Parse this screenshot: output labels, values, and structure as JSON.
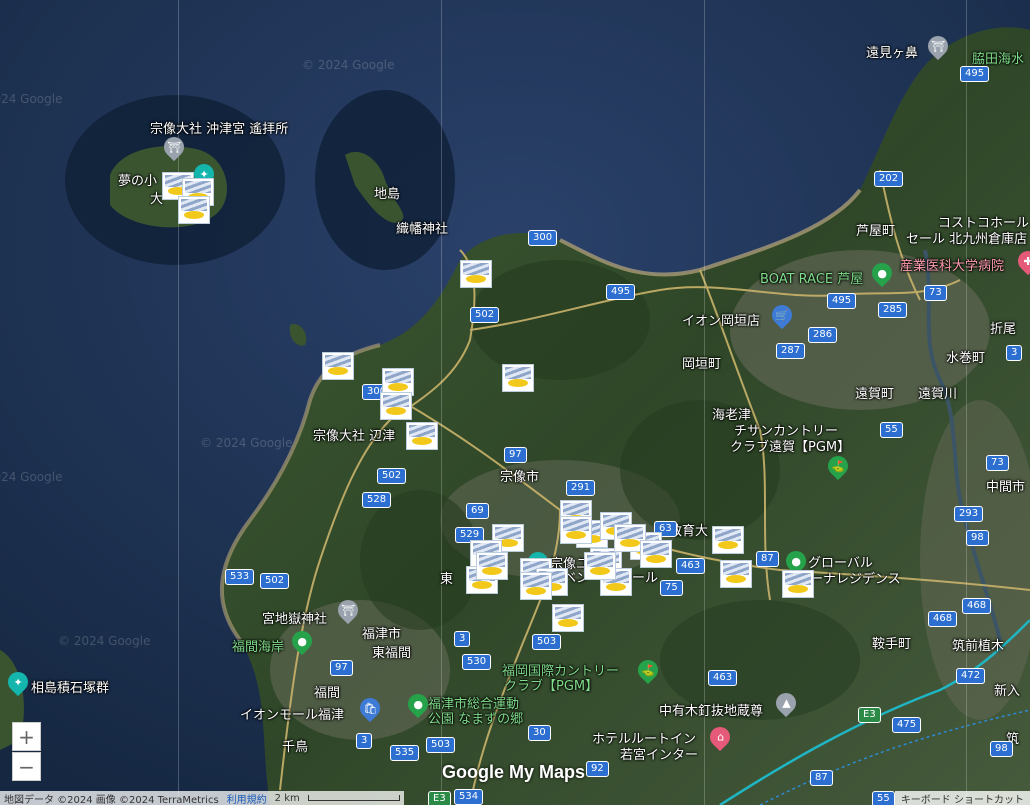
{
  "watermark": "© 2024 Google",
  "place_labels": [
    {
      "text": "遠見ヶ鼻",
      "cls": ""
    },
    {
      "text": "脇田海水",
      "cls": "green"
    },
    {
      "text": "宗像大社 沖津宮 遙拝所",
      "cls": ""
    },
    {
      "text": "夢の小",
      "cls": ""
    },
    {
      "text": "大",
      "cls": ""
    },
    {
      "text": "地島",
      "cls": ""
    },
    {
      "text": "織幡神社",
      "cls": ""
    },
    {
      "text": "芦屋町",
      "cls": ""
    },
    {
      "text": "コストコホール",
      "cls": ""
    },
    {
      "text": "セール 北九州倉庫店",
      "cls": ""
    },
    {
      "text": "産業医科大学病院",
      "cls": "pink"
    },
    {
      "text": "BOAT RACE 芦屋",
      "cls": "green"
    },
    {
      "text": "イオン岡垣店",
      "cls": ""
    },
    {
      "text": "折尾",
      "cls": ""
    },
    {
      "text": "岡垣町",
      "cls": ""
    },
    {
      "text": "水巻町",
      "cls": ""
    },
    {
      "text": "遠賀町",
      "cls": ""
    },
    {
      "text": "遠賀川",
      "cls": ""
    },
    {
      "text": "海老津",
      "cls": ""
    },
    {
      "text": "チサンカントリー",
      "cls": ""
    },
    {
      "text": "クラブ遠賀【PGM】",
      "cls": ""
    },
    {
      "text": "宗像大社 辺津",
      "cls": ""
    },
    {
      "text": "宗像市",
      "cls": ""
    },
    {
      "text": "中間市",
      "cls": ""
    },
    {
      "text": "教育大",
      "cls": ""
    },
    {
      "text": "宗像ユ",
      "cls": ""
    },
    {
      "text": "イベン",
      "cls": ""
    },
    {
      "text": "ール",
      "cls": ""
    },
    {
      "text": "東",
      "cls": ""
    },
    {
      "text": "グローバル",
      "cls": ""
    },
    {
      "text": "アリーナレジデンス",
      "cls": ""
    },
    {
      "text": "宮地嶽神社",
      "cls": ""
    },
    {
      "text": "福間海岸",
      "cls": "green"
    },
    {
      "text": "福津市",
      "cls": ""
    },
    {
      "text": "東福間",
      "cls": ""
    },
    {
      "text": "鞍手町",
      "cls": ""
    },
    {
      "text": "筑前植木",
      "cls": ""
    },
    {
      "text": "相島積石塚群",
      "cls": ""
    },
    {
      "text": "福間",
      "cls": ""
    },
    {
      "text": "福岡国際カントリー",
      "cls": "green"
    },
    {
      "text": "クラブ【PGM】",
      "cls": "green"
    },
    {
      "text": "新入",
      "cls": ""
    },
    {
      "text": "イオンモール福津",
      "cls": ""
    },
    {
      "text": "福津市総合運動",
      "cls": "green"
    },
    {
      "text": "公園 なまずの郷",
      "cls": "green"
    },
    {
      "text": "中有木釘抜地蔵尊",
      "cls": ""
    },
    {
      "text": "千鳥",
      "cls": ""
    },
    {
      "text": "ホテルルートイン",
      "cls": ""
    },
    {
      "text": "若宮インター",
      "cls": ""
    },
    {
      "text": "筑",
      "cls": ""
    }
  ],
  "road_shields": [
    "495",
    "202",
    "300",
    "495",
    "285",
    "73",
    "502",
    "286",
    "287",
    "495",
    "3",
    "300",
    "55",
    "502",
    "73",
    "97",
    "291",
    "528",
    "69",
    "529",
    "63",
    "87",
    "98",
    "293",
    "533",
    "502",
    "463",
    "75",
    "468",
    "468",
    "3",
    "97",
    "530",
    "503",
    "472",
    "463",
    "475",
    "503",
    "535",
    "3",
    "30",
    "98",
    "92",
    "534",
    "87",
    "55"
  ],
  "highway_shields": [
    "E3",
    "E3"
  ],
  "pins": [
    {
      "icon": "⛩",
      "color": "#9aa3ad"
    },
    {
      "icon": "✦",
      "color": "#13b5ad"
    },
    {
      "icon": "⛩",
      "color": "#9aa3ad"
    },
    {
      "icon": "●",
      "color": "#25a24a"
    },
    {
      "icon": "🛒",
      "color": "#3d7bd6"
    },
    {
      "icon": "✚",
      "color": "#e55a78"
    },
    {
      "icon": "⛳",
      "color": "#25a24a"
    },
    {
      "icon": "●",
      "color": "#25a24a"
    },
    {
      "icon": "⛩",
      "color": "#9aa3ad"
    },
    {
      "icon": "●",
      "color": "#25a24a"
    },
    {
      "icon": "✦",
      "color": "#13b5ad"
    },
    {
      "icon": "🛍",
      "color": "#3d7bd6"
    },
    {
      "icon": "●",
      "color": "#25a24a"
    },
    {
      "icon": "⛳",
      "color": "#25a24a"
    },
    {
      "icon": "▲",
      "color": "#9aa3ad"
    },
    {
      "icon": "⌂",
      "color": "#e55a78"
    },
    {
      "icon": "✦",
      "color": "#13b5ad"
    }
  ],
  "photo_markers_count": 30,
  "zoom": {
    "in": "+",
    "out": "−"
  },
  "logo": "Google My Maps",
  "footer": {
    "map_data": "地図データ ©2024 画像 ©2024 TerraMetrics",
    "terms": "利用規約",
    "scale": "2 km"
  },
  "keyboard_shortcuts": "キーボード ショートカット"
}
